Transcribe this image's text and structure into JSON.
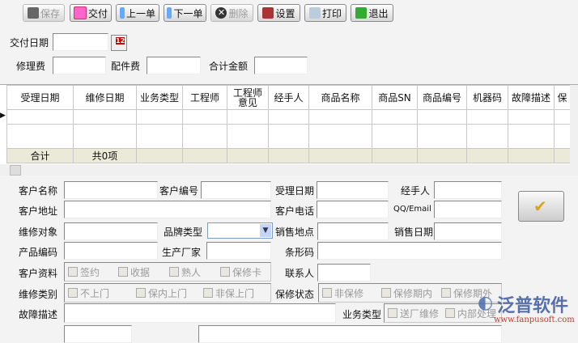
{
  "toolbar": {
    "save": "保存",
    "deliver": "交付",
    "prev": "上一单",
    "next": "下一单",
    "delete": "删除",
    "settings": "设置",
    "print": "打印",
    "exit": "退出"
  },
  "top_form": {
    "deliver_date": "交付日期",
    "repair_fee": "修理费",
    "parts_fee": "配件费",
    "total": "合计金额",
    "calendar_badge": "12"
  },
  "grid": {
    "columns": [
      "受理日期",
      "维修日期",
      "业务类型",
      "工程师",
      "工程师意见",
      "经手人",
      "商品名称",
      "商品SN",
      "商品编号",
      "机器码",
      "故障描述",
      "保"
    ],
    "footer": [
      "合计",
      "共0项"
    ]
  },
  "form": {
    "customer_name": "客户名称",
    "customer_no": "客户编号",
    "accept_date": "受理日期",
    "handler": "经手人",
    "customer_addr": "客户地址",
    "customer_phone": "客户电话",
    "qq_email": "QQ/Email",
    "repair_object": "维修对象",
    "brand_type": "品牌类型",
    "sale_place": "销售地点",
    "sale_date": "销售日期",
    "product_code": "产品编码",
    "manufacturer": "生产厂家",
    "barcode": "条形码",
    "customer_docs": "客户资料",
    "docs_options": [
      "签约",
      "收据",
      "熟人",
      "保修卡"
    ],
    "contact": "联系人",
    "repair_kind": "维修类别",
    "kind_options": [
      "不上门",
      "保内上门",
      "非保上门"
    ],
    "warranty_status": "保修状态",
    "warranty_options": [
      "非保修",
      "保修期内",
      "保修期外"
    ],
    "fault_desc": "故障描述",
    "business_type": "业务类型",
    "business_options": [
      "送厂维修",
      "内部处理"
    ]
  },
  "watermark": {
    "brand": "泛普软件",
    "url": "www.fanpusoft.com"
  }
}
